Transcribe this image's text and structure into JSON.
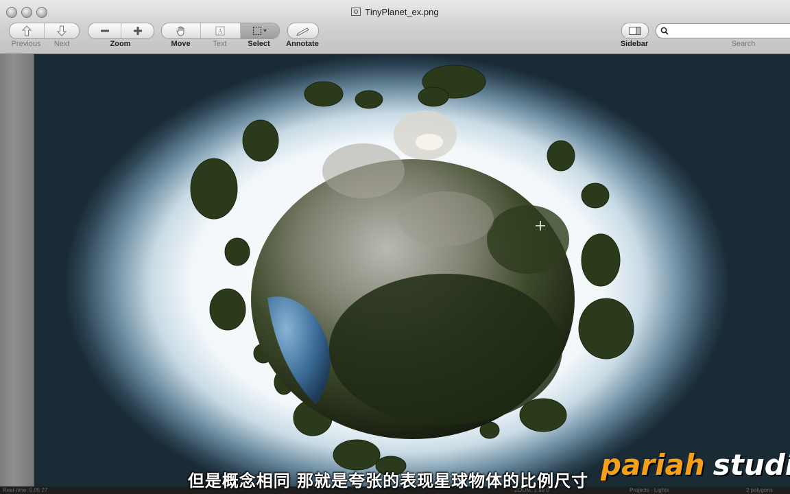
{
  "window": {
    "title": "TinyPlanet_ex.png"
  },
  "toolbar": {
    "previous_label": "Previous",
    "next_label": "Next",
    "zoom_label": "Zoom",
    "move_label": "Move",
    "text_label": "Text",
    "select_label": "Select",
    "annotate_label": "Annotate",
    "sidebar_label": "Sidebar",
    "search_label": "Search",
    "search_value": ""
  },
  "icons": {
    "previous": "up-arrow-icon",
    "next": "down-arrow-icon",
    "zoom_out": "minus-icon",
    "zoom_in": "plus-icon",
    "move": "hand-icon",
    "text": "text-cursor-icon",
    "select": "marquee-select-icon",
    "annotate": "pencil-icon",
    "sidebar": "sidebar-icon",
    "search": "magnifier-icon"
  },
  "overlay": {
    "subtitle": "但是概念相同 那就是夸张的表现星球物体的比例尺寸",
    "watermark_a": "pariah",
    "watermark_b": "studio",
    "watermark_color": "#f5a01a"
  },
  "status_bar": {
    "left": "Real-time: 0.05 27",
    "center_a": "ZOOM: 1 99 0",
    "center_b": "Projects · Lights",
    "right": "2 polygons"
  },
  "colors": {
    "toolbar_bg": "#d8d8d8",
    "canvas_center": "#ffffff",
    "canvas_edge": "#1a2b36"
  }
}
